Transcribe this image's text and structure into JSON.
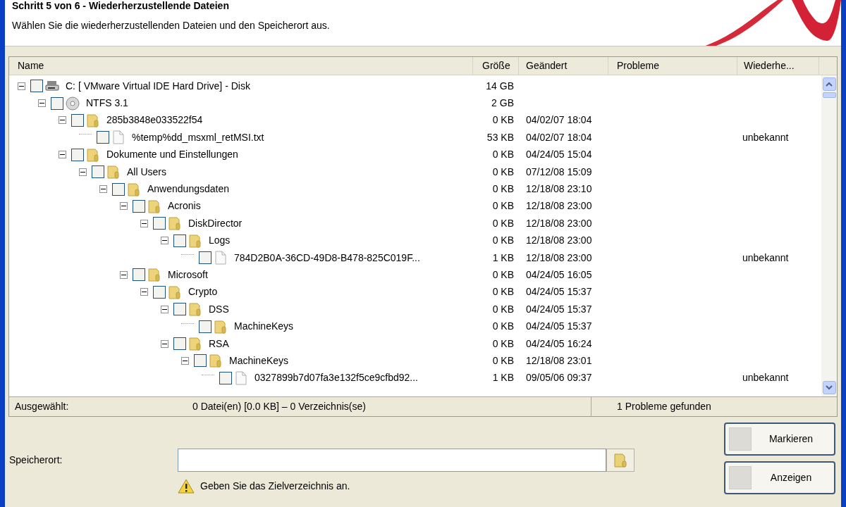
{
  "header": {
    "title": "Schritt 5 von 6 - Wiederherzustellende Dateien",
    "subtitle": "Wählen Sie die wiederherzustellenden Dateien und den Speicherort aus."
  },
  "table": {
    "columns": [
      "Name",
      "Größe",
      "Geändert",
      "Probleme",
      "Wiederhe..."
    ],
    "tree": [
      {
        "kind": "drive",
        "name": "C: [ VMware Virtual IDE Hard Drive] - Disk",
        "size": "14 GB",
        "checked": false,
        "expanded": true,
        "children": [
          {
            "kind": "volume",
            "name": "NTFS 3.1",
            "size": "2 GB",
            "checked": false,
            "expanded": true,
            "children": [
              {
                "kind": "folder",
                "name": "285b3848e033522f54",
                "size": "0 KB",
                "modified": "04/02/07 18:04",
                "checked": false,
                "expanded": true,
                "children": [
                  {
                    "kind": "file",
                    "name": "%temp%dd_msxml_retMSI.txt",
                    "size": "53 KB",
                    "modified": "04/02/07 18:04",
                    "column_5": "unbekannt",
                    "checked": false
                  }
                ]
              },
              {
                "kind": "folder",
                "name": "Dokumente und Einstellungen",
                "size": "0 KB",
                "modified": "04/24/05 15:04",
                "checked": false,
                "expanded": true,
                "children": [
                  {
                    "kind": "folder",
                    "name": "All Users",
                    "size": "0 KB",
                    "modified": "07/12/08 15:09",
                    "checked": false,
                    "expanded": true,
                    "children": [
                      {
                        "kind": "folder",
                        "name": "Anwendungsdaten",
                        "size": "0 KB",
                        "modified": "12/18/08 23:10",
                        "checked": false,
                        "expanded": true,
                        "children": [
                          {
                            "kind": "folder",
                            "name": "Acronis",
                            "size": "0 KB",
                            "modified": "12/18/08 23:00",
                            "checked": false,
                            "expanded": true,
                            "children": [
                              {
                                "kind": "folder",
                                "name": "DiskDirector",
                                "size": "0 KB",
                                "modified": "12/18/08 23:00",
                                "checked": false,
                                "expanded": true,
                                "children": [
                                  {
                                    "kind": "folder",
                                    "name": "Logs",
                                    "size": "0 KB",
                                    "modified": "12/18/08 23:00",
                                    "checked": false,
                                    "expanded": true,
                                    "children": [
                                      {
                                        "kind": "file",
                                        "name": "784D2B0A-36CD-49D8-B478-825C019F...",
                                        "size": "1 KB",
                                        "modified": "12/18/08 23:00",
                                        "column_5": "unbekannt",
                                        "checked": false
                                      }
                                    ]
                                  }
                                ]
                              }
                            ]
                          },
                          {
                            "kind": "folder",
                            "name": "Microsoft",
                            "size": "0 KB",
                            "modified": "04/24/05 16:05",
                            "checked": false,
                            "expanded": true,
                            "children": [
                              {
                                "kind": "folder",
                                "name": "Crypto",
                                "size": "0 KB",
                                "modified": "04/24/05 15:37",
                                "checked": false,
                                "expanded": true,
                                "children": [
                                  {
                                    "kind": "folder",
                                    "name": "DSS",
                                    "size": "0 KB",
                                    "modified": "04/24/05 15:37",
                                    "checked": false,
                                    "expanded": true,
                                    "children": [
                                      {
                                        "kind": "folder",
                                        "name": "MachineKeys",
                                        "size": "0 KB",
                                        "modified": "04/24/05 15:37",
                                        "checked": false
                                      }
                                    ]
                                  },
                                  {
                                    "kind": "folder",
                                    "name": "RSA",
                                    "size": "0 KB",
                                    "modified": "04/24/05 16:24",
                                    "checked": false,
                                    "expanded": true,
                                    "children": [
                                      {
                                        "kind": "folder",
                                        "name": "MachineKeys",
                                        "size": "0 KB",
                                        "modified": "12/18/08 23:01",
                                        "checked": false,
                                        "expanded": true,
                                        "children": [
                                          {
                                            "kind": "file",
                                            "name": "0327899b7d07fa3e132f5ce9cfbd92...",
                                            "size": "1 KB",
                                            "modified": "09/05/06 09:37",
                                            "column_5": "unbekannt",
                                            "checked": false
                                          }
                                        ]
                                      }
                                    ]
                                  }
                                ]
                              }
                            ]
                          }
                        ]
                      }
                    ]
                  }
                ]
              }
            ]
          }
        ]
      }
    ]
  },
  "status_bar": {
    "label": "Ausgewählt:",
    "selection": "0 Datei(en) [0.0 KB] – 0 Verzeichnis(se)",
    "problems": "1 Probleme gefunden"
  },
  "destination": {
    "label": "Speicherort:",
    "hint": "Geben Sie das Zielverzeichnis an."
  },
  "buttons": [
    "Markieren",
    "Anzeigen"
  ]
}
